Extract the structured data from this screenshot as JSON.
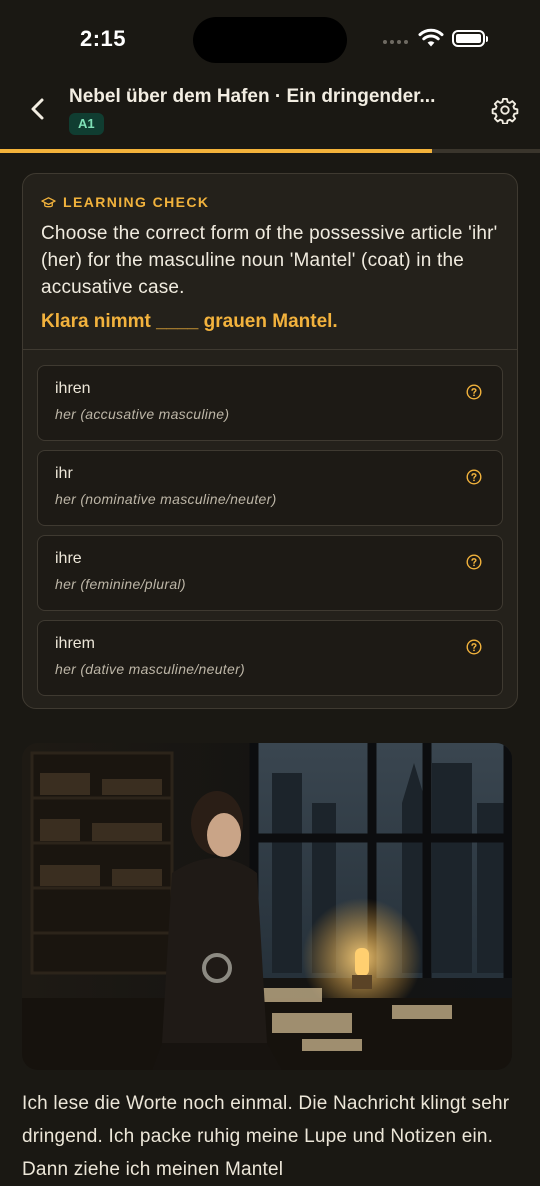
{
  "status_bar": {
    "time": "2:15"
  },
  "header": {
    "title": "Nebel über dem Hafen · Ein dringender...",
    "level": "A1"
  },
  "progress": {
    "fraction": 0.8
  },
  "learning_check": {
    "label": "LEARNING CHECK",
    "question": "Choose the correct form of the possessive article 'ihr' (her) for the masculine noun 'Mantel' (coat) in the accusative case.",
    "sentence": "Klara nimmt ____ grauen Mantel.",
    "options": [
      {
        "word": "ihren",
        "gloss": "her (accusative masculine)"
      },
      {
        "word": "ihr",
        "gloss": "her (nominative masculine/neuter)"
      },
      {
        "word": "ihre",
        "gloss": "her (feminine/plural)"
      },
      {
        "word": "ihrem",
        "gloss": "her (dative masculine/neuter)"
      }
    ]
  },
  "story": {
    "text": "Ich lese die Worte noch einmal. Die Nachricht klingt sehr dringend. Ich packe ruhig meine Lupe und Notizen ein. Dann ziehe ich meinen Mantel"
  },
  "colors": {
    "accent": "#f3b23a",
    "background": "#1a1813",
    "card": "#24211b",
    "level_badge_bg": "#103d31",
    "level_badge_text": "#7fe0b6"
  },
  "icons": [
    "back-chevron-icon",
    "gear-icon",
    "graduation-cap-icon",
    "help-circle-icon",
    "wifi-icon",
    "battery-icon",
    "signal-icon"
  ]
}
